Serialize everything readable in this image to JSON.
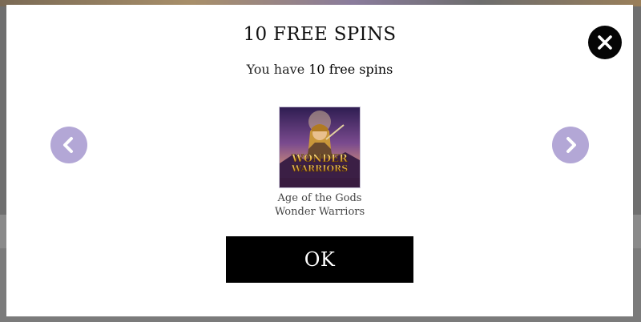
{
  "modal": {
    "title": "10 FREE SPINS",
    "subtitle_prefix": "You have ",
    "subtitle_highlight": "10 free spins",
    "ok_label": "OK"
  },
  "game": {
    "name_line1": "Age of the Gods",
    "name_line2": "Wonder Warriors",
    "thumb_logo_line1": "WONDER",
    "thumb_logo_line2": "WARRIORS"
  },
  "icons": {
    "close": "close-icon",
    "prev": "chevron-left-icon",
    "next": "chevron-right-icon"
  },
  "colors": {
    "nav_button": "#b3a7d6",
    "close_button": "#050505",
    "ok_button": "#000000",
    "overlay": "#6f6f6f"
  }
}
